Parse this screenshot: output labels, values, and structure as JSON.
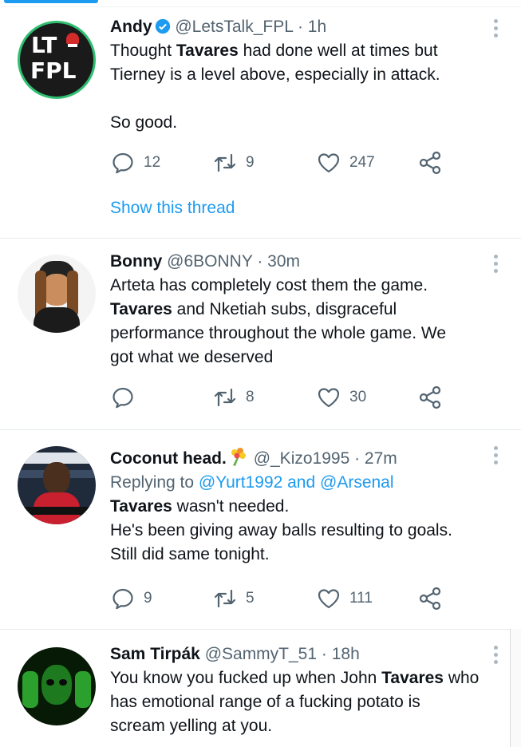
{
  "tweets": [
    {
      "name": "Andy",
      "handle": "@LetsTalk_FPL",
      "time": "· 1h",
      "verified": true,
      "avatar_text_1": "LT",
      "avatar_text_2": "FPL",
      "text_lines": [
        [
          {
            "t": "Thought "
          },
          {
            "t": "Tavares",
            "b": true
          },
          {
            "t": " had done well at times but"
          }
        ],
        [
          {
            "t": "Tierney is a level above, especially in attack."
          }
        ],
        [],
        [
          {
            "t": "So good."
          }
        ]
      ],
      "replies": "12",
      "retweets": "9",
      "likes": "247",
      "show_thread": "Show this thread"
    },
    {
      "name": "Bonny",
      "handle": "@6BONNY",
      "time": "· 30m",
      "text_lines": [
        [
          {
            "t": "Arteta has completely cost them the game."
          }
        ],
        [
          {
            "t": "Tavares",
            "b": true
          },
          {
            "t": " and Nketiah subs, disgraceful"
          }
        ],
        [
          {
            "t": "performance throughout the whole game. We"
          }
        ],
        [
          {
            "t": "got what we deserved"
          }
        ]
      ],
      "replies": "",
      "retweets": "8",
      "likes": "30"
    },
    {
      "name": "Coconut head.",
      "handle": "@_Kizo1995",
      "time": "· 27m",
      "reply_prefix": "Replying to",
      "reply_targets": "@Yurt1992 and @Arsenal",
      "text_lines": [
        [
          {
            "t": "Tavares",
            "b": true
          },
          {
            "t": " wasn't needed."
          }
        ],
        [
          {
            "t": "He's been giving away balls resulting to goals."
          }
        ],
        [
          {
            "t": "Still did same tonight."
          }
        ]
      ],
      "replies": "9",
      "retweets": "5",
      "likes": "111"
    },
    {
      "name": "Sam Tirpák",
      "handle": "@SammyT_51",
      "time": "· 18h",
      "text_lines": [
        [
          {
            "t": "You know you fucked up when John "
          },
          {
            "t": "Tavares",
            "b": true
          },
          {
            "t": " who"
          }
        ],
        [
          {
            "t": "has emotional range of a fucking potato is"
          }
        ],
        [
          {
            "t": "scream yelling at you."
          }
        ]
      ]
    }
  ],
  "icons": {
    "reply": "reply-icon",
    "retweet": "retweet-icon",
    "like": "heart-icon",
    "share": "share-icon",
    "more": "more-options-icon"
  },
  "colors": {
    "accent": "#1d9bf0",
    "secondary_text": "#536471",
    "primary_text": "#0f1419"
  }
}
